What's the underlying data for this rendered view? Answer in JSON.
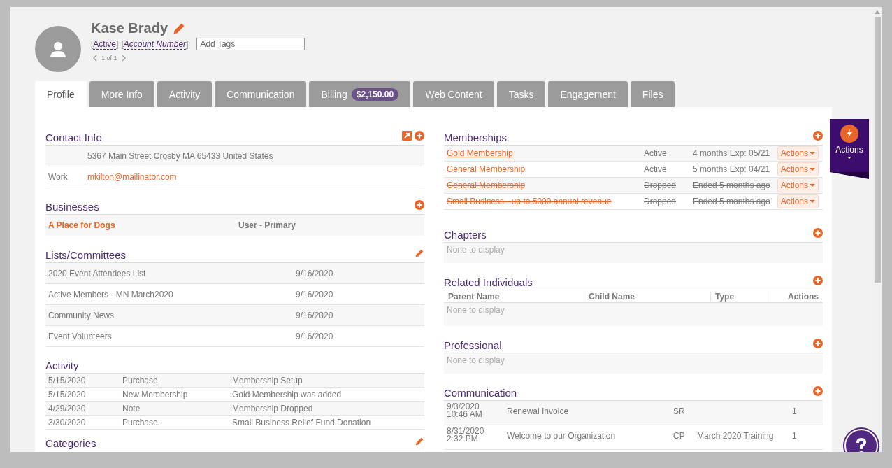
{
  "profile": {
    "name": "Kase Brady",
    "status": {
      "open": "[",
      "label": "Active",
      "close": "]"
    },
    "account_number": {
      "open": "[",
      "label": "Account Number",
      "close": "]"
    },
    "tags_placeholder": "Add Tags",
    "pager": "1 of 1"
  },
  "tabs": [
    {
      "label": "Profile",
      "selected": true
    },
    {
      "label": "More Info",
      "selected": false
    },
    {
      "label": "Activity",
      "selected": false
    },
    {
      "label": "Communication",
      "selected": false
    },
    {
      "label": "Billing",
      "badge": "$2,150.00",
      "selected": false
    },
    {
      "label": "Web Content",
      "selected": false
    },
    {
      "label": "Tasks",
      "selected": false
    },
    {
      "label": "Engagement",
      "selected": false
    },
    {
      "label": "Files",
      "selected": false
    }
  ],
  "left_column": [
    {
      "kind": "contact",
      "title": "Contact Info",
      "rows": [
        {
          "label": "",
          "value": "5367 Main Street Crosby MA 65433 United States",
          "link": false
        },
        {
          "label": "Work",
          "value": "mkilton@mailinator.com",
          "link": true
        }
      ]
    },
    {
      "kind": "businesses",
      "title": "Businesses",
      "rows": [
        {
          "name": "A Place for Dogs",
          "role": "User - Primary"
        }
      ]
    },
    {
      "kind": "lists",
      "title": "Lists/Committees",
      "rows": [
        {
          "name": "2020 Event Attendees List",
          "date": "9/16/2020"
        },
        {
          "name": "Active Members - MN March2020",
          "date": "9/16/2020"
        },
        {
          "name": "Community News",
          "date": "9/16/2020"
        },
        {
          "name": "Event Volunteers",
          "date": "9/16/2020"
        }
      ]
    },
    {
      "kind": "activity",
      "title": "Activity",
      "rows": [
        {
          "date": "5/15/2020",
          "type": "Purchase",
          "description": "Membership Setup"
        },
        {
          "date": "5/15/2020",
          "type": "New Membership",
          "description": "Gold Membership was added"
        },
        {
          "date": "4/29/2020",
          "type": "Note",
          "description": "Membership Dropped"
        },
        {
          "date": "3/30/2020",
          "type": "Purchase",
          "description": "Small Business Relief Fund Donation"
        }
      ]
    },
    {
      "kind": "categories",
      "title": "Categories"
    }
  ],
  "right_column": [
    {
      "kind": "memberships",
      "title": "Memberships",
      "rows": [
        {
          "name": "Gold Membership",
          "status": "Active",
          "term": "4 months Exp: 05/21",
          "dropped": false,
          "action": "Actions"
        },
        {
          "name": "General Membership",
          "status": "Active",
          "term": "5 months Exp: 04/21",
          "dropped": false,
          "action": "Actions"
        },
        {
          "name": "General Membership",
          "status": "Dropped",
          "term": "Ended 5 months ago",
          "dropped": true,
          "action": "Actions"
        },
        {
          "name": "Small Business - up to 5000 annual revenue",
          "status": "Dropped",
          "term": "Ended 5 months ago",
          "dropped": true,
          "action": "Actions"
        }
      ]
    },
    {
      "kind": "empty",
      "title": "Chapters",
      "empty": "None to display"
    },
    {
      "kind": "related",
      "title": "Related Individuals",
      "columns": [
        "Parent Name",
        "Child Name",
        "Type",
        "Actions"
      ],
      "empty": "None to display"
    },
    {
      "kind": "empty",
      "title": "Professional",
      "empty": "None to display"
    },
    {
      "kind": "communication",
      "title": "Communication",
      "rows": [
        {
          "date": "9/3/2020 10:46 AM",
          "subject": "Renewal Invoice",
          "initials": "SR",
          "event": "",
          "count": "1"
        },
        {
          "date": "8/31/2020 2:32 PM",
          "subject": "Welcome to our Organization",
          "initials": "CP",
          "event": "March 2020 Training",
          "count": "1"
        }
      ]
    }
  ],
  "actions_panel": {
    "label": "Actions"
  }
}
